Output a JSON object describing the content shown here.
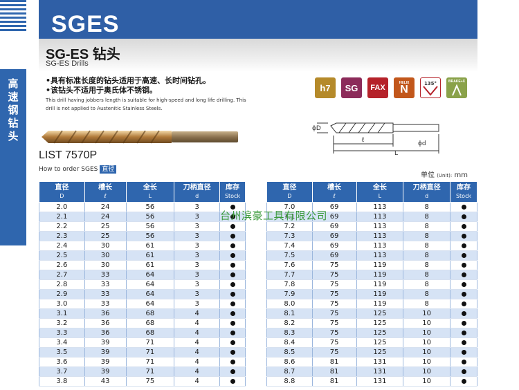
{
  "side_tab": [
    "高",
    "速",
    "钢",
    "钻",
    "头"
  ],
  "header": {
    "title": "SGES"
  },
  "product": {
    "name": "SG-ES 钻头",
    "english": "SG-ES Drills"
  },
  "bullets": [
    "具有标准长度的钻头适用于高速、长时间钻孔。",
    "该钻头不适用于奥氏体不锈钢。"
  ],
  "description_en": "This drill having jobbers length is suitable for high-speed and long life drilling. This drill is not applied to Austenitic Stainless Steels.",
  "icons": [
    {
      "label": "h7",
      "color": "#b58a2a"
    },
    {
      "label": "SG",
      "color": "#8c2b5a"
    },
    {
      "label": "FAX",
      "color": "#b5222a"
    },
    {
      "label": "N",
      "top_label": "HELIX",
      "color": "#c2571b"
    },
    {
      "label": "135°",
      "color": "#ffffff"
    },
    {
      "label": "BRAKE+X",
      "color": "#8aa24a"
    }
  ],
  "diagram": {
    "phi_D": "ϕD",
    "l": "ℓ",
    "L": "L",
    "phi_d": "ϕd"
  },
  "list_title": "LIST 7570P",
  "order": {
    "text": "How to order SGES",
    "badge": "直径"
  },
  "unit": {
    "cn": "单位",
    "en": "(Unit):",
    "value": "mm"
  },
  "table_headers": [
    {
      "cn": "直径",
      "sub": "D"
    },
    {
      "cn": "槽长",
      "sub": "ℓ"
    },
    {
      "cn": "全长",
      "sub": "L"
    },
    {
      "cn": "刀柄直径",
      "sub": "d"
    },
    {
      "cn": "库存",
      "sub": "Stock"
    }
  ],
  "left_rows": [
    [
      "2.0",
      "24",
      "56",
      "3"
    ],
    [
      "2.1",
      "24",
      "56",
      "3"
    ],
    [
      "2.2",
      "25",
      "56",
      "3"
    ],
    [
      "2.3",
      "25",
      "56",
      "3"
    ],
    [
      "2.4",
      "30",
      "61",
      "3"
    ],
    [
      "2.5",
      "30",
      "61",
      "3"
    ],
    [
      "2.6",
      "30",
      "61",
      "3"
    ],
    [
      "2.7",
      "33",
      "64",
      "3"
    ],
    [
      "2.8",
      "33",
      "64",
      "3"
    ],
    [
      "2.9",
      "33",
      "64",
      "3"
    ],
    [
      "3.0",
      "33",
      "64",
      "3"
    ],
    [
      "3.1",
      "36",
      "68",
      "4"
    ],
    [
      "3.2",
      "36",
      "68",
      "4"
    ],
    [
      "3.3",
      "36",
      "68",
      "4"
    ],
    [
      "3.4",
      "39",
      "71",
      "4"
    ],
    [
      "3.5",
      "39",
      "71",
      "4"
    ],
    [
      "3.6",
      "39",
      "71",
      "4"
    ],
    [
      "3.7",
      "39",
      "71",
      "4"
    ],
    [
      "3.8",
      "43",
      "75",
      "4"
    ]
  ],
  "right_rows": [
    [
      "7.0",
      "69",
      "113",
      "8"
    ],
    [
      "7.1",
      "69",
      "113",
      "8"
    ],
    [
      "7.2",
      "69",
      "113",
      "8"
    ],
    [
      "7.3",
      "69",
      "113",
      "8"
    ],
    [
      "7.4",
      "69",
      "113",
      "8"
    ],
    [
      "7.5",
      "69",
      "113",
      "8"
    ],
    [
      "7.6",
      "75",
      "119",
      "8"
    ],
    [
      "7.7",
      "75",
      "119",
      "8"
    ],
    [
      "7.8",
      "75",
      "119",
      "8"
    ],
    [
      "7.9",
      "75",
      "119",
      "8"
    ],
    [
      "8.0",
      "75",
      "119",
      "8"
    ],
    [
      "8.1",
      "75",
      "125",
      "10"
    ],
    [
      "8.2",
      "75",
      "125",
      "10"
    ],
    [
      "8.3",
      "75",
      "125",
      "10"
    ],
    [
      "8.4",
      "75",
      "125",
      "10"
    ],
    [
      "8.5",
      "75",
      "125",
      "10"
    ],
    [
      "8.6",
      "81",
      "131",
      "10"
    ],
    [
      "8.7",
      "81",
      "131",
      "10"
    ],
    [
      "8.8",
      "81",
      "131",
      "10"
    ]
  ],
  "stock_symbol": "●",
  "watermark": "台州滨豪工具有限公司"
}
